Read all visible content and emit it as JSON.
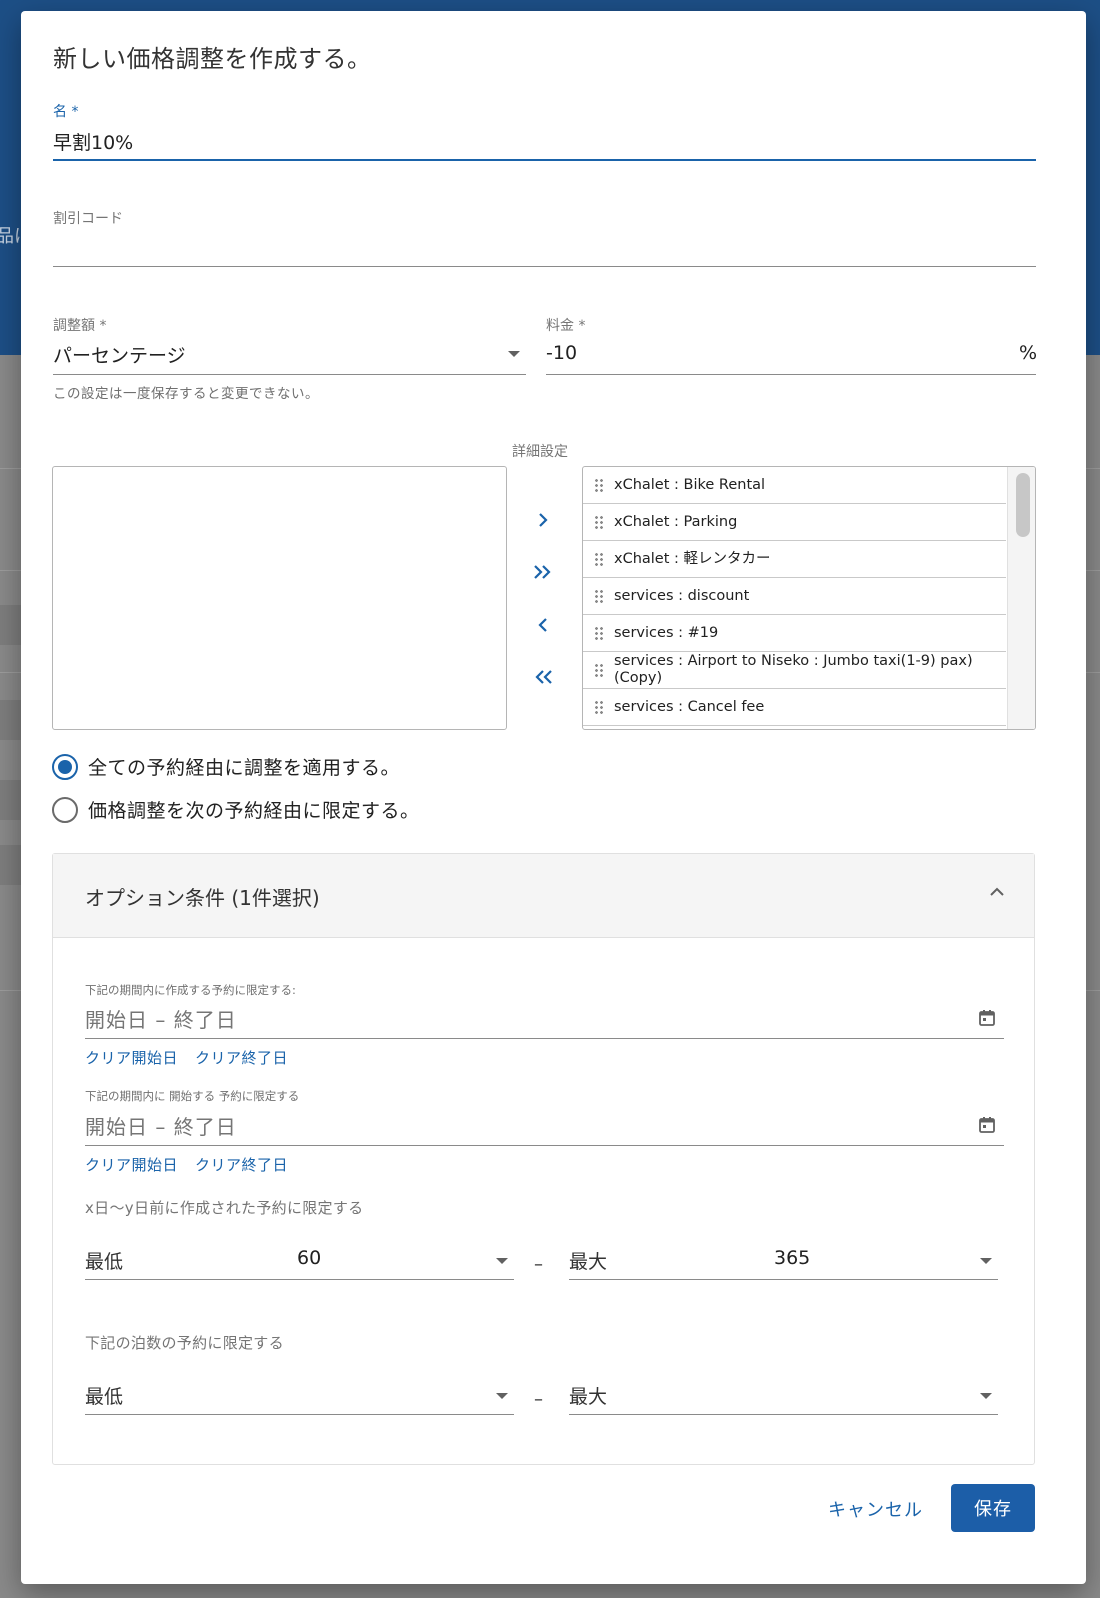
{
  "background": {
    "partial_text": "品に"
  },
  "dialog": {
    "title": "新しい価格調整を作成する。",
    "name_field": {
      "label": "名 *",
      "value": "早割10%"
    },
    "discount_code_field": {
      "label": "割引コード",
      "value": ""
    },
    "adjustment_type": {
      "label": "調整額 *",
      "value": "パーセンテージ",
      "hint": "この設定は一度保存すると変更できない。"
    },
    "rate_field": {
      "label": "料金 *",
      "value": "-10",
      "suffix": "%"
    },
    "detail_settings_label": "詳細設定",
    "transfer_list": {
      "available_items": [],
      "selected_items": [
        "xChalet : Bike Rental",
        "xChalet : Parking",
        "xChalet : 軽レンタカー",
        "services : discount",
        "services : #19",
        "services : Airport to Niseko : Jumbo taxi(1-9) pax) (Copy)",
        "services : Cancel fee"
      ],
      "buttons": {
        "move_right": "›",
        "move_all_right": "»",
        "move_left": "‹",
        "move_all_left": "«"
      }
    },
    "channel_options": {
      "selected": "all",
      "options": [
        {
          "id": "all",
          "label": "全ての予約経由に調整を適用する。"
        },
        {
          "id": "limited",
          "label": "価格調整を次の予約経由に限定する。"
        }
      ]
    },
    "optional_conditions": {
      "title": "オプション条件 (1件選択)",
      "expanded": true,
      "created_period": {
        "label": "下記の期間内に作成する予約に限定する:",
        "placeholder": "開始日 – 終了日",
        "clear_start": "クリア開始日",
        "clear_end": "クリア終了日"
      },
      "start_period": {
        "label": "下記の期間内に 開始する 予約に限定する",
        "placeholder": "開始日 – 終了日",
        "clear_start": "クリア開始日",
        "clear_end": "クリア終了日"
      },
      "days_before": {
        "label": "x日〜y日前に作成された予約に限定する",
        "min_label": "最低",
        "min_value": "60",
        "separator": "–",
        "max_label": "最大",
        "max_value": "365"
      },
      "nights": {
        "label": "下記の泊数の予約に限定する",
        "min_label": "最低",
        "min_value": "",
        "separator": "–",
        "max_label": "最大",
        "max_value": ""
      }
    },
    "actions": {
      "cancel": "キャンセル",
      "save": "保存"
    }
  },
  "colors": {
    "primary": "#1a63aa",
    "header_bg": "#1d4f86",
    "save_button": "#1c5ea8"
  }
}
